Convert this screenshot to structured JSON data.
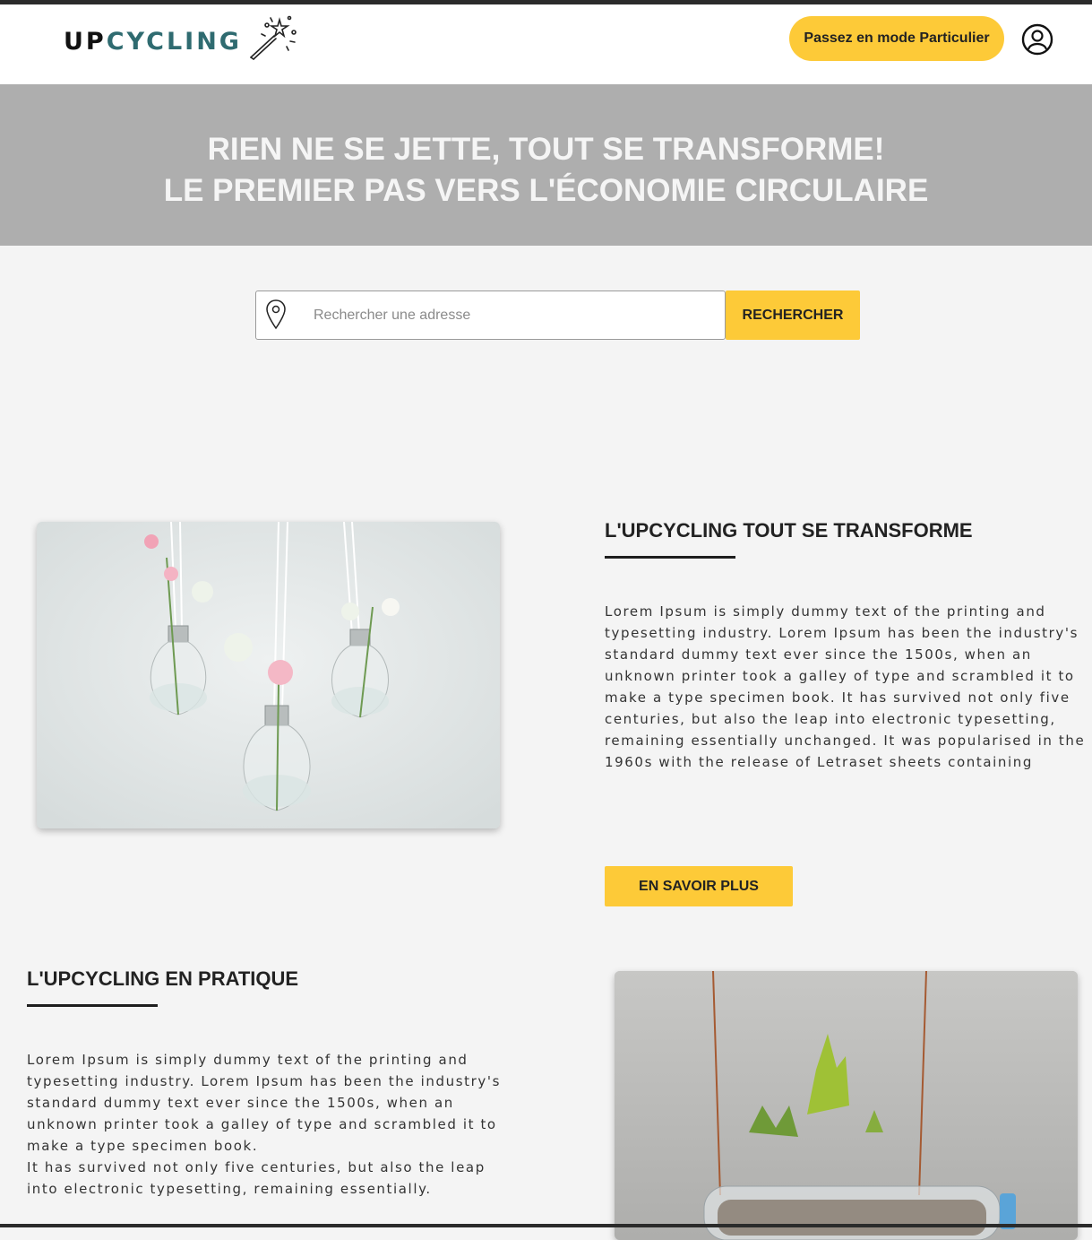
{
  "header": {
    "logo_up": "UP",
    "logo_cycling": "CYCLING",
    "mode_button": "Passez en mode Particulier"
  },
  "hero": {
    "line1": "RIEN NE SE JETTE, TOUT SE TRANSFORME!",
    "line2": "LE PREMIER PAS VERS L'ÉCONOMIE CIRCULAIRE"
  },
  "search": {
    "placeholder": "Rechercher une adresse",
    "value": "",
    "button": "RECHERCHER"
  },
  "section1": {
    "title": "L'UPCYCLING TOUT SE TRANSFORME",
    "body": "Lorem Ipsum is simply dummy text of the printing and\ntypesetting industry. Lorem Ipsum has been the industry's\nstandard dummy text ever since the 1500s, when an\nunknown printer took a galley of type and scrambled it to\nmake a type specimen book. It has survived not only five\ncenturies, but also the leap into electronic typesetting,\nremaining essentially unchanged. It was popularised in the\n1960s with the release of Letraset sheets containing",
    "button": "EN SAVOIR PLUS",
    "image_icon": "lightbulb-vases-photo"
  },
  "section2": {
    "title": "L'UPCYCLING EN PRATIQUE",
    "body": "Lorem Ipsum is simply dummy text of the printing and\ntypesetting industry. Lorem Ipsum has been the industry's\nstandard dummy text ever since the 1500s, when an\nunknown printer took a galley of type and scrambled it to\nmake a type specimen book.\n It has survived not only five centuries, but also the leap\ninto electronic typesetting, remaining essentially.",
    "image_icon": "bottle-planter-photo"
  },
  "colors": {
    "accent": "#fdca38",
    "logo_teal": "#2f6b70",
    "hero_bg": "#aeaeae",
    "page_bg": "#f4f4f4"
  }
}
